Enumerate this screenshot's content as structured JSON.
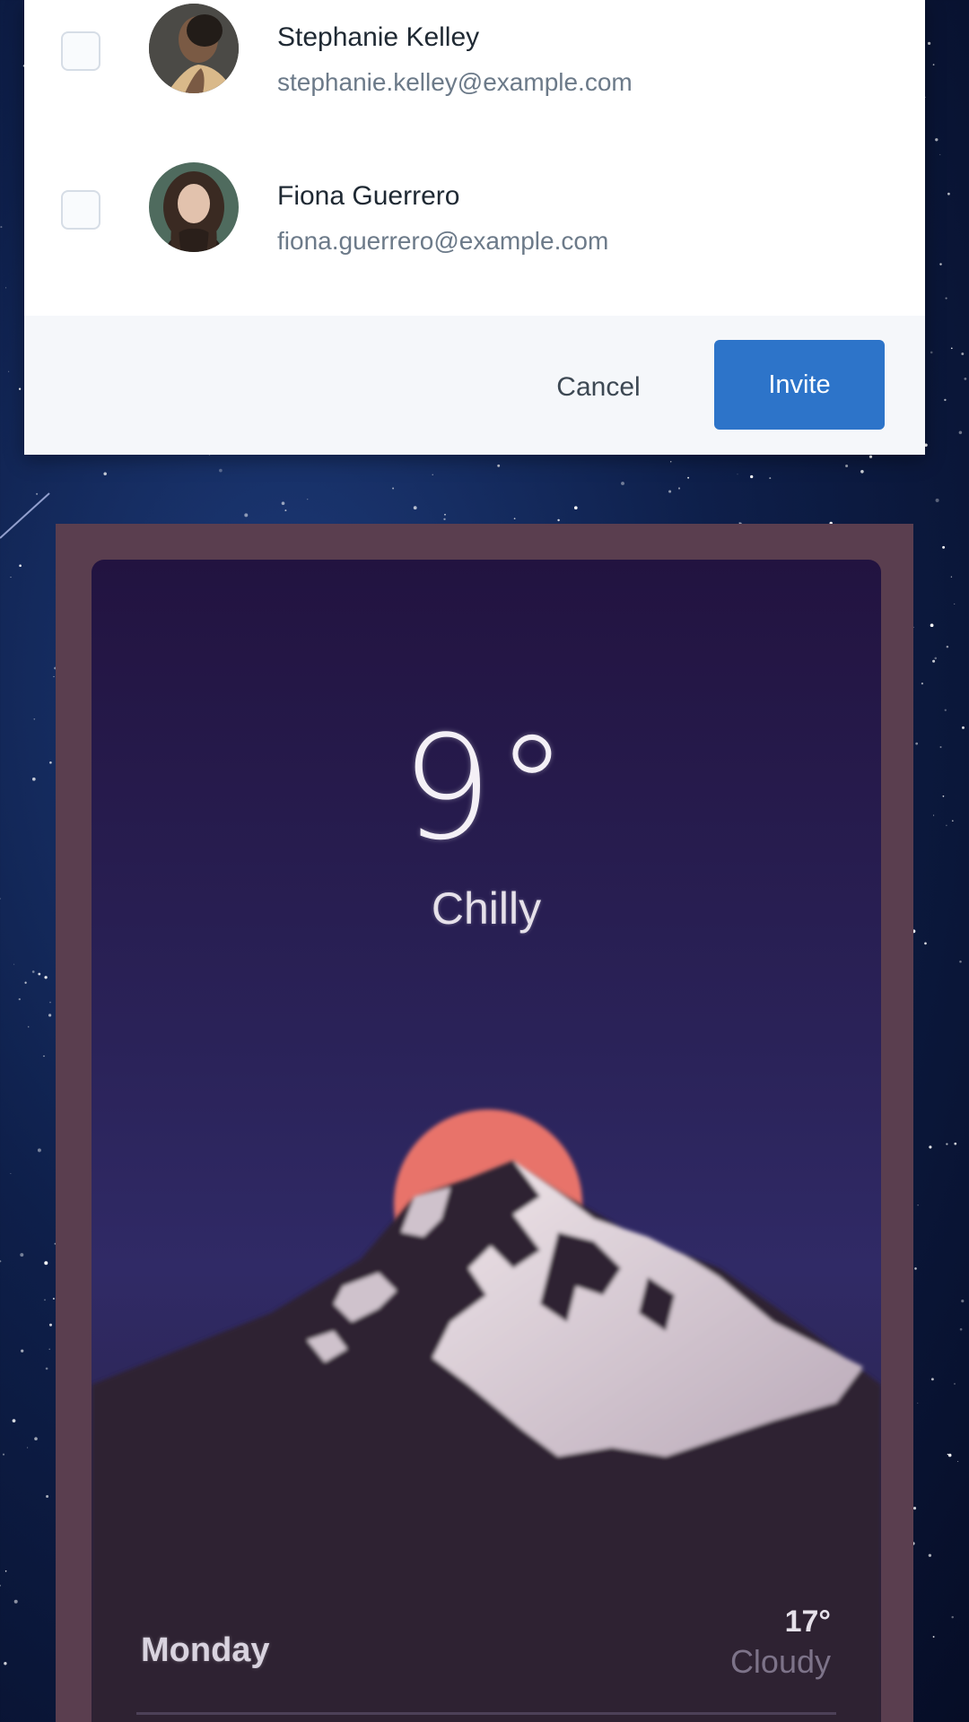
{
  "contacts": [
    {
      "name": "Stephanie Kelley",
      "email": "stephanie.kelley@example.com"
    },
    {
      "name": "Fiona Guerrero",
      "email": "fiona.guerrero@example.com"
    }
  ],
  "footer": {
    "cancel_label": "Cancel",
    "invite_label": "Invite"
  },
  "weather": {
    "temperature": "9°",
    "condition": "Chilly",
    "forecast": {
      "day": "Monday",
      "temperature": "17°",
      "condition": "Cloudy"
    }
  },
  "colors": {
    "invite_button": "#2d74c9",
    "sun": "#e8736a",
    "frame": "#5a3e4f"
  }
}
